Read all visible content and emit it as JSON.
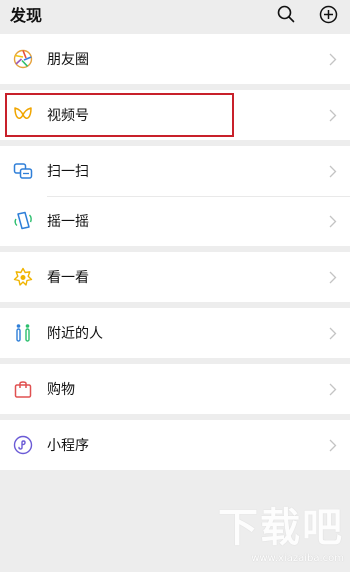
{
  "header": {
    "title": "发现"
  },
  "icons": {
    "search": "search-icon",
    "add": "plus-circle-icon"
  },
  "menu": {
    "moments": "朋友圈",
    "channels": "视频号",
    "scan": "扫一扫",
    "shake": "摇一摇",
    "top_stories": "看一看",
    "nearby": "附近的人",
    "shopping": "购物",
    "mini_programs": "小程序"
  },
  "watermark": {
    "main": "下载吧",
    "sub": "www.xiazaiba.com"
  },
  "colors": {
    "highlight": "#c8202a",
    "background": "#ededed"
  }
}
